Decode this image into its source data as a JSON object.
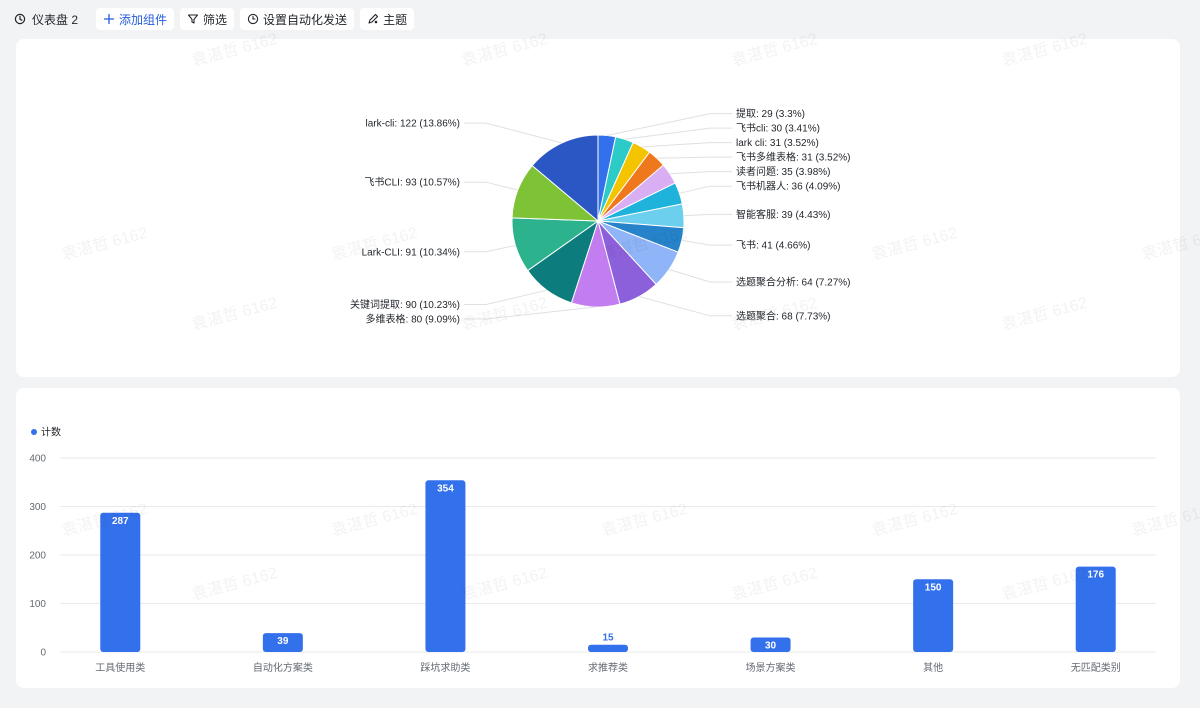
{
  "toolbar": {
    "title": "仪表盘 2",
    "add_component": "添加组件",
    "filter": "筛选",
    "auto_send": "设置自动化发送",
    "theme": "主题"
  },
  "watermark": "袁湛哲 6162",
  "pie_chart": {
    "type": "pie",
    "slices": [
      {
        "label": "提取: 29 (3.3%)",
        "value": 29,
        "color": "#3370eb"
      },
      {
        "label": "飞书cli: 30 (3.41%)",
        "value": 30,
        "color": "#2ccbc7"
      },
      {
        "label": "lark cli: 31 (3.52%)",
        "value": 31,
        "color": "#f5c400"
      },
      {
        "label": "飞书多维表格: 31 (3.52%)",
        "value": 31,
        "color": "#f0781c"
      },
      {
        "label": "读者问题: 35 (3.98%)",
        "value": 35,
        "color": "#d9aef2"
      },
      {
        "label": "飞书机器人: 36 (4.09%)",
        "value": 36,
        "color": "#1fb2db"
      },
      {
        "label": "智能客服: 39 (4.43%)",
        "value": 39,
        "color": "#6dcfee"
      },
      {
        "label": "飞书: 41 (4.66%)",
        "value": 41,
        "color": "#2683c9"
      },
      {
        "label": "选题聚合分析: 64 (7.27%)",
        "value": 64,
        "color": "#8fb4f7"
      },
      {
        "label": "选题聚合: 68 (7.73%)",
        "value": 68,
        "color": "#8d60db"
      },
      {
        "label": "多维表格: 80 (9.09%)",
        "value": 80,
        "color": "#c27ef0"
      },
      {
        "label": "关键词提取: 90 (10.23%)",
        "value": 90,
        "color": "#0c7c7c"
      },
      {
        "label": "Lark-CLI: 91 (10.34%)",
        "value": 91,
        "color": "#2cb38e"
      },
      {
        "label": "飞书CLI: 93 (10.57%)",
        "value": 93,
        "color": "#7ec235"
      },
      {
        "label": "lark-cli: 122 (13.86%)",
        "value": 122,
        "color": "#2b57c4"
      }
    ]
  },
  "chart_data": {
    "type": "bar",
    "categories": [
      "工具使用类",
      "自动化方案类",
      "踩坑求助类",
      "求推荐类",
      "场景方案类",
      "其他",
      "无匹配类别"
    ],
    "series": [
      {
        "name": "计数",
        "values": [
          287,
          39,
          354,
          15,
          30,
          150,
          176
        ],
        "color": "#3370eb"
      }
    ],
    "ylim": [
      0,
      400
    ],
    "yticks": [
      0,
      100,
      200,
      300,
      400
    ],
    "grid": true,
    "legend": "top-left"
  }
}
